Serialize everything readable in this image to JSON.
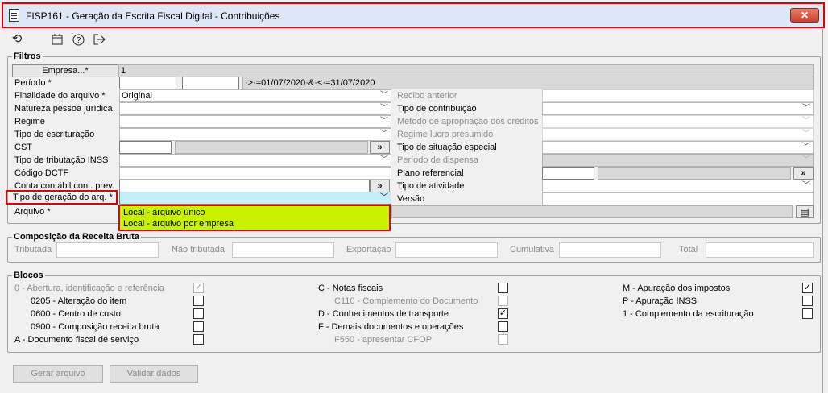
{
  "window": {
    "title": "FISP161 - Geração da Escrita Fiscal Digital - Contribuições",
    "close_label": "✕"
  },
  "toolbar": {
    "icons": [
      "refresh-icon",
      "calendar-icon",
      "help-icon",
      "exit-icon"
    ]
  },
  "filtros": {
    "title": "Filtros",
    "empresa_button": "Empresa...*",
    "empresa_value": "1",
    "periodo_label": "Período *",
    "periodo_value": "·>·=01/07/2020·&·<·=31/07/2020",
    "finalidade_label": "Finalidade do arquivo *",
    "finalidade_value": "Original",
    "natureza_label": "Natureza pessoa jurídica",
    "regime_label": "Regime",
    "tipo_escrituracao_label": "Tipo de escrituração",
    "cst_label": "CST",
    "tipo_tributacao_label": "Tipo de tributação INSS",
    "codigo_dctf_label": "Código DCTF",
    "conta_contabil_label": "Conta contábil cont. prev.",
    "tipo_geracao_label": "Tipo de geração do arq. *",
    "arquivo_label": "Arquivo *",
    "recibo_label": "Recibo anterior",
    "tipo_contribuicao_label": "Tipo de contribuição",
    "metodo_label": "Método de apropriação dos créditos",
    "regime_lucro_label": "Regime lucro presumido",
    "tipo_situacao_label": "Tipo de situação especial",
    "periodo_dispensa_label": "Período de dispensa",
    "plano_referencial_label": "Plano referencial",
    "tipo_atividade_label": "Tipo de atividade",
    "versao_label": "Versão",
    "dropdown_options": [
      "Local - arquivo único",
      "Local - arquivo por empresa"
    ],
    "lookup_label": "»"
  },
  "receita": {
    "title": "Composição da Receita Bruta",
    "fields": [
      "Tributada",
      "Não tributada",
      "Exportação",
      "Cumulativa",
      "Total"
    ]
  },
  "blocos": {
    "title": "Blocos",
    "items": [
      {
        "label": "0 - Abertura, identificação e referência",
        "checked": true,
        "disabled": true
      },
      {
        "label": "0205 - Alteração do item",
        "checked": false,
        "disabled": false
      },
      {
        "label": "0600 - Centro de custo",
        "checked": false,
        "disabled": false
      },
      {
        "label": "0900 - Composição receita bruta",
        "checked": false,
        "disabled": false
      },
      {
        "label": "A - Documento fiscal de serviço",
        "checked": false,
        "disabled": false
      },
      {
        "label": "C - Notas fiscais",
        "checked": false,
        "disabled": false
      },
      {
        "label": "C110 - Complemento do Documento",
        "checked": false,
        "disabled": true
      },
      {
        "label": "D - Conhecimentos de transporte",
        "checked": true,
        "disabled": false
      },
      {
        "label": "F - Demais documentos e operações",
        "checked": false,
        "disabled": false
      },
      {
        "label": "F550 - apresentar CFOP",
        "checked": false,
        "disabled": true
      },
      {
        "label": "M - Apuração dos impostos",
        "checked": true,
        "disabled": false
      },
      {
        "label": "P - Apuração INSS",
        "checked": false,
        "disabled": false
      },
      {
        "label": "1 - Complemento da escrituração",
        "checked": false,
        "disabled": false
      }
    ]
  },
  "actions": {
    "gerar": "Gerar arquivo",
    "validar": "Validar dados"
  }
}
